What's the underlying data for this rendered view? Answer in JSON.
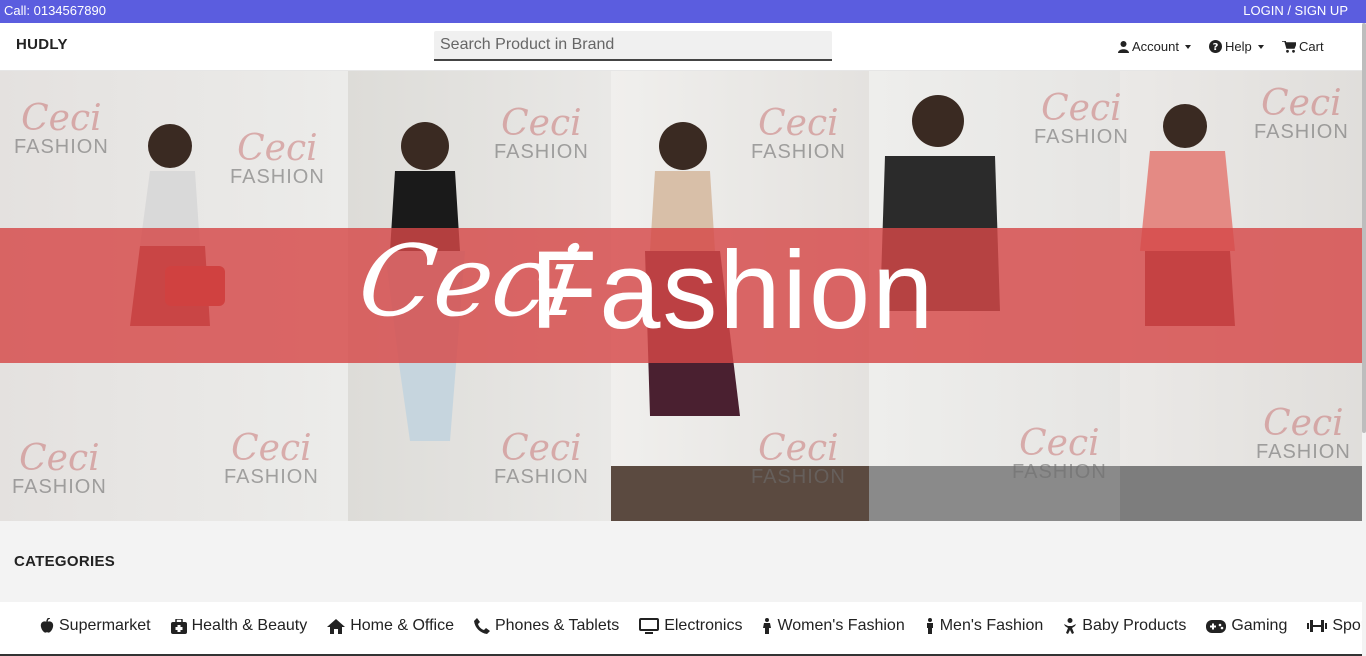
{
  "topbar": {
    "call": "Call: 0134567890",
    "login": "LOGIN / SIGN UP"
  },
  "navbar": {
    "brand": "HUDLY",
    "search_placeholder": "Search Product in Brand",
    "account": "Account",
    "help": "Help",
    "cart": "Cart"
  },
  "hero": {
    "logo_script": "Ceci",
    "logo_word": "Fashion",
    "watermark_script": "Ceci",
    "watermark_word": "FASHION"
  },
  "categories": {
    "heading": "CATEGORIES",
    "items": [
      {
        "label": "Supermarket",
        "icon": "apple-icon"
      },
      {
        "label": "Health & Beauty",
        "icon": "first-aid-kit-icon"
      },
      {
        "label": "Home & Office",
        "icon": "home-icon"
      },
      {
        "label": "Phones & Tablets",
        "icon": "phone-icon"
      },
      {
        "label": "Electronics",
        "icon": "monitor-icon"
      },
      {
        "label": "Women's Fashion",
        "icon": "female-icon"
      },
      {
        "label": "Men's Fashion",
        "icon": "male-icon"
      },
      {
        "label": "Baby Products",
        "icon": "baby-icon"
      },
      {
        "label": "Gaming",
        "icon": "gamepad-icon"
      },
      {
        "label": "Sporting Goods",
        "icon": "dumbbell-icon"
      }
    ]
  },
  "colors": {
    "topbar": "#5b5ddf",
    "band": "#d64848"
  }
}
